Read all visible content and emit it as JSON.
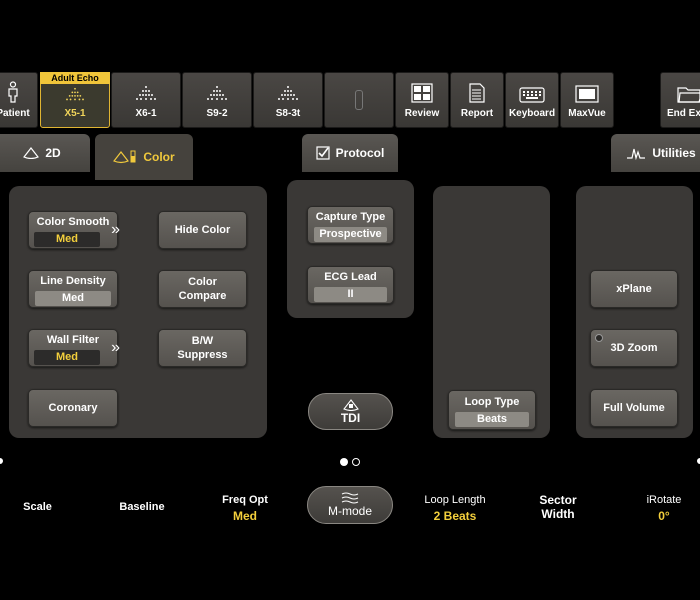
{
  "toolbar": {
    "patient": "Patient",
    "adult_echo_tag": "Adult Echo",
    "probes": [
      "X5-1",
      "X6-1",
      "S9-2",
      "S8-3t"
    ],
    "review": "Review",
    "report": "Report",
    "keyboard": "Keyboard",
    "maxvue": "MaxVue",
    "end_exam": "End Exam"
  },
  "tabs": {
    "mode_2d": "2D",
    "color": "Color",
    "protocol": "Protocol",
    "utilities": "Utilities"
  },
  "color_panel": {
    "color_smooth": {
      "label": "Color Smooth",
      "value": "Med"
    },
    "line_density": {
      "label": "Line Density",
      "value": "Med"
    },
    "wall_filter": {
      "label": "Wall Filter",
      "value": "Med"
    },
    "coronary": "Coronary",
    "hide_color": "Hide Color",
    "color_compare_1": "Color",
    "color_compare_2": "Compare",
    "bw_suppress_1": "B/W",
    "bw_suppress_2": "Suppress"
  },
  "protocol_panel": {
    "capture_type": {
      "label": "Capture Type",
      "value": "Prospective"
    },
    "ecg_lead": {
      "label": "ECG Lead",
      "value": "II"
    },
    "tdi": "TDI"
  },
  "loop_panel": {
    "loop_type": {
      "label": "Loop Type",
      "value": "Beats"
    }
  },
  "utilities_panel": {
    "xplane": "xPlane",
    "zoom_3d": "3D Zoom",
    "full_volume": "Full Volume"
  },
  "bottom_bar": {
    "scale": "Scale",
    "baseline": "Baseline",
    "freq_opt": {
      "label": "Freq Opt",
      "value": "Med"
    },
    "mmode": "M-mode",
    "loop_length": {
      "label": "Loop Length",
      "value": "2 Beats"
    },
    "sector_width_1": "Sector",
    "sector_width_2": "Width",
    "irotate": {
      "label": "iRotate",
      "value": "0°"
    }
  },
  "colors": {
    "accent_yellow": "#f3cf3c",
    "panel_bg": "#3a3836",
    "button_bg": "#5f5c57"
  }
}
